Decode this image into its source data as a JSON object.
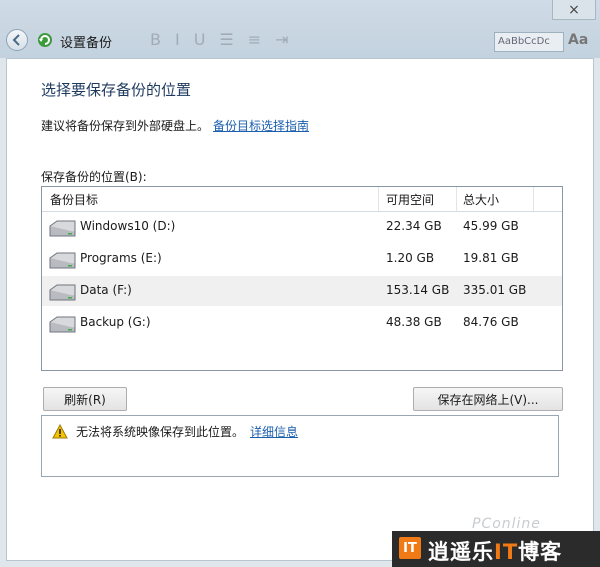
{
  "window": {
    "title": "设置备份",
    "close_glyph": "×"
  },
  "background": {
    "search_ghost": "AaBbCcDc",
    "ghost_label": "Aa"
  },
  "heading": "选择要保存备份的位置",
  "advice": {
    "text": "建议将备份保存到外部硬盘上。",
    "link": "备份目标选择指南"
  },
  "location_label": "保存备份的位置(B):",
  "table": {
    "headers": {
      "target": "备份目标",
      "free": "可用空间",
      "total": "总大小"
    },
    "rows": [
      {
        "name": "Windows10 (D:)",
        "free": "22.34 GB",
        "total": "45.99 GB",
        "icon": "drive-icon"
      },
      {
        "name": "Programs (E:)",
        "free": "1.20 GB",
        "total": "19.81 GB",
        "icon": "drive-icon"
      },
      {
        "name": "Data (F:)",
        "free": "153.14 GB",
        "total": "335.01 GB",
        "icon": "drive-icon"
      },
      {
        "name": "Backup (G:)",
        "free": "48.38 GB",
        "total": "84.76 GB",
        "icon": "drive-icon"
      }
    ],
    "highlighted_row": 2
  },
  "buttons": {
    "refresh": "刷新(R)",
    "save_network": "保存在网络上(V)..."
  },
  "warning": {
    "text": "无法将系统映像保存到此位置。",
    "link": "详细信息",
    "icon": "warning-icon"
  },
  "watermark": {
    "pconline": "PConline",
    "logo": "IT",
    "site_pre": "逍遥乐",
    "site_it": "IT",
    "site_post": "博客"
  },
  "colors": {
    "link": "#1b5fae",
    "heading": "#1e3a5f",
    "accent": "#f07a15"
  }
}
